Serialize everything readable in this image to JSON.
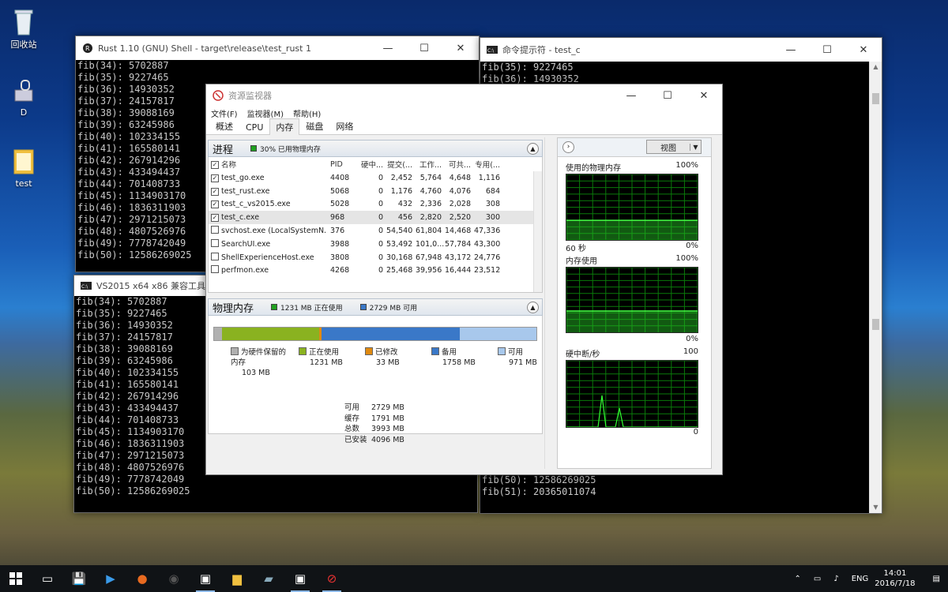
{
  "desktop": {
    "icons": [
      {
        "label": "回收站",
        "icon": "recycle-bin-icon"
      },
      {
        "label": "D",
        "icon": "drive-icon"
      },
      {
        "label": "test",
        "icon": "folder-icon"
      }
    ]
  },
  "windows": {
    "rust_shell": {
      "title": "Rust 1.10 (GNU) Shell - target\\release\\test_rust  1",
      "lines": [
        "fib(34): 5702887",
        "fib(35): 9227465",
        "fib(36): 14930352",
        "fib(37): 24157817",
        "fib(38): 39088169",
        "fib(39): 63245986",
        "fib(40): 102334155",
        "fib(41): 165580141",
        "fib(42): 267914296",
        "fib(43): 433494437",
        "fib(44): 701408733",
        "fib(45): 1134903170",
        "fib(46): 1836311903",
        "fib(47): 2971215073",
        "fib(48): 4807526976",
        "fib(49): 7778742049",
        "fib(50): 12586269025"
      ]
    },
    "cmd_c": {
      "title": "命令提示符 - test_c",
      "lines_top": [
        "fib(35): 9227465",
        "fib(36): 14930352"
      ],
      "lines_bottom": [
        "fib(50): 12586269025",
        "fib(51): 20365011074"
      ]
    },
    "vs2015": {
      "title": "VS2015 x64 x86 兼容工具命令",
      "lines": [
        "fib(34): 5702887",
        "fib(35): 9227465",
        "fib(36): 14930352",
        "fib(37): 24157817",
        "fib(38): 39088169",
        "fib(39): 63245986",
        "fib(40): 102334155",
        "fib(41): 165580141",
        "fib(42): 267914296",
        "fib(43): 433494437",
        "fib(44): 701408733",
        "fib(45): 1134903170",
        "fib(46): 1836311903",
        "fib(47): 2971215073",
        "fib(48): 4807526976",
        "fib(49): 7778742049",
        "fib(50): 12586269025"
      ]
    }
  },
  "resmon": {
    "title": "资源监视器",
    "menu": [
      "文件(F)",
      "监视器(M)",
      "帮助(H)"
    ],
    "tabs": [
      "概述",
      "CPU",
      "内存",
      "磁盘",
      "网络"
    ],
    "active_tab": "内存",
    "processes": {
      "title": "进程",
      "legend": "30% 已用物理内存",
      "columns": [
        "名称",
        "PID",
        "硬中...",
        "提交(...",
        "工作...",
        "可共...",
        "专用(..."
      ],
      "rows": [
        {
          "checked": "✓",
          "name": "test_go.exe",
          "pid": "4408",
          "hard": "0",
          "commit": "2,452",
          "work": "5,764",
          "share": "4,648",
          "priv": "1,116"
        },
        {
          "checked": "✓",
          "name": "test_rust.exe",
          "pid": "5068",
          "hard": "0",
          "commit": "1,176",
          "work": "4,760",
          "share": "4,076",
          "priv": "684"
        },
        {
          "checked": "✓",
          "name": "test_c_vs2015.exe",
          "pid": "5028",
          "hard": "0",
          "commit": "432",
          "work": "2,336",
          "share": "2,028",
          "priv": "308"
        },
        {
          "checked": "✓",
          "name": "test_c.exe",
          "pid": "968",
          "hard": "0",
          "commit": "456",
          "work": "2,820",
          "share": "2,520",
          "priv": "300"
        },
        {
          "checked": "",
          "name": "svchost.exe (LocalSystemN...",
          "pid": "376",
          "hard": "0",
          "commit": "54,540",
          "work": "61,804",
          "share": "14,468",
          "priv": "47,336"
        },
        {
          "checked": "",
          "name": "SearchUI.exe",
          "pid": "3988",
          "hard": "0",
          "commit": "53,492",
          "work": "101,0...",
          "share": "57,784",
          "priv": "43,300"
        },
        {
          "checked": "",
          "name": "ShellExperienceHost.exe",
          "pid": "3808",
          "hard": "0",
          "commit": "30,168",
          "work": "67,948",
          "share": "43,172",
          "priv": "24,776"
        },
        {
          "checked": "",
          "name": "perfmon.exe",
          "pid": "4268",
          "hard": "0",
          "commit": "25,468",
          "work": "39,956",
          "share": "16,444",
          "priv": "23,512"
        }
      ]
    },
    "physical": {
      "title": "物理内存",
      "legend_inuse": "1231 MB 正在使用",
      "legend_avail": "2729 MB 可用",
      "bar": {
        "reserved": 103,
        "inuse": 1231,
        "modified": 33,
        "standby": 1758,
        "free": 971,
        "total": 4096
      },
      "legend": [
        {
          "name": "为硬件保留的内存",
          "value": "103 MB",
          "color": "#b0b0b0"
        },
        {
          "name": "正在使用",
          "value": "1231 MB",
          "color": "#8ab220"
        },
        {
          "name": "已修改",
          "value": "33 MB",
          "color": "#e08a10"
        },
        {
          "name": "备用",
          "value": "1758 MB",
          "color": "#3a78c8"
        },
        {
          "name": "可用",
          "value": "971 MB",
          "color": "#a8c8ec"
        }
      ],
      "stats": [
        {
          "k": "可用",
          "v": "2729 MB"
        },
        {
          "k": "缓存",
          "v": "1791 MB"
        },
        {
          "k": "总数",
          "v": "3993 MB"
        },
        {
          "k": "已安装",
          "v": "4096 MB"
        }
      ]
    },
    "graphs": {
      "view_button": "视图",
      "used_physical": {
        "label": "使用的物理内存",
        "max": "100%",
        "min": "0%",
        "time": "60 秒",
        "level": 0.3
      },
      "commit": {
        "label": "内存使用",
        "max": "100%",
        "min": "0%",
        "level": 0.33
      },
      "hard_faults": {
        "label": "硬中断/秒",
        "max": "100",
        "min": "0"
      }
    }
  },
  "taskbar": {
    "lang": "ENG",
    "time": "14:01",
    "date": "2016/7/18"
  }
}
